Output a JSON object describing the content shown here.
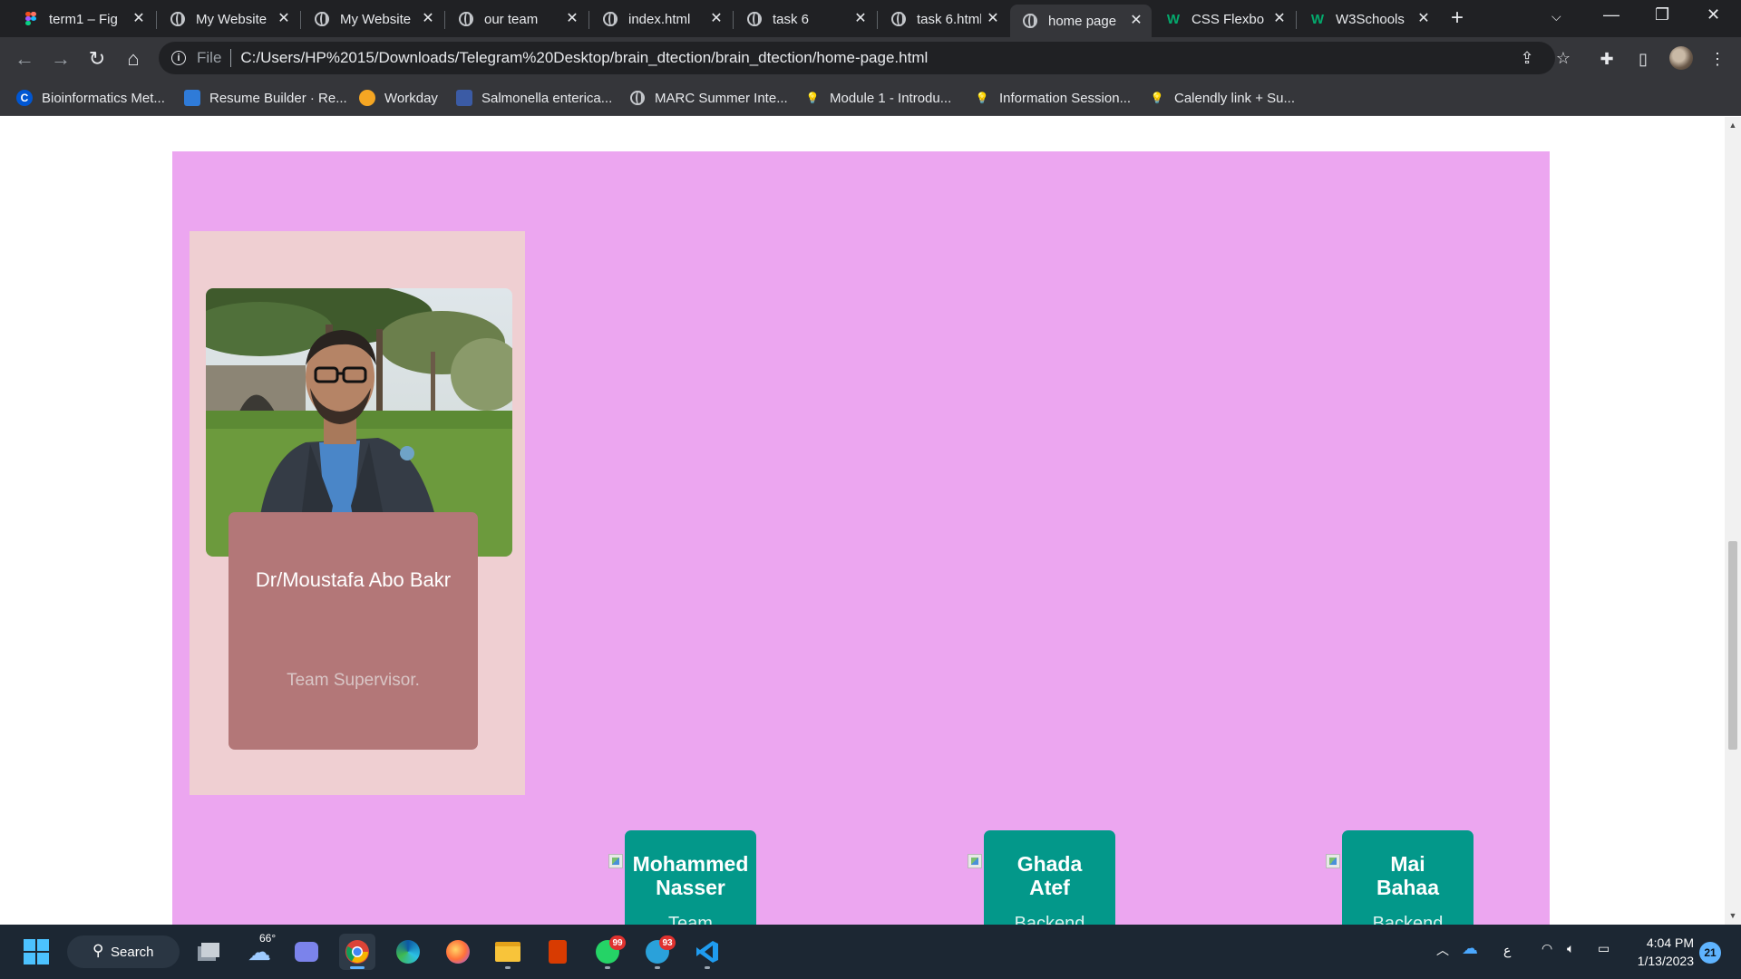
{
  "browser": {
    "tabs": [
      {
        "title": "term1 – Fig",
        "icon": "figma-icon",
        "active": false
      },
      {
        "title": "My Website",
        "icon": "globe-icon",
        "active": false
      },
      {
        "title": "My Website",
        "icon": "globe-icon",
        "active": false
      },
      {
        "title": "our team",
        "icon": "globe-icon",
        "active": false
      },
      {
        "title": "index.html",
        "icon": "globe-icon",
        "active": false
      },
      {
        "title": "task 6",
        "icon": "globe-icon",
        "active": false
      },
      {
        "title": "task 6.html",
        "icon": "globe-icon",
        "active": false
      },
      {
        "title": "home page",
        "icon": "globe-icon",
        "active": true
      },
      {
        "title": "CSS Flexbo",
        "icon": "w3schools-icon",
        "active": false
      },
      {
        "title": "W3Schools",
        "icon": "w3schools-icon",
        "active": false
      }
    ],
    "address": {
      "scheme": "File",
      "url": "C:/Users/HP%2015/Downloads/Telegram%20Desktop/brain_dtection/brain_dtection/home-page.html"
    },
    "bookmarks": [
      {
        "label": "Bioinformatics Met...",
        "icon": "coursera-icon"
      },
      {
        "label": "Resume Builder · Re...",
        "icon": "resume-icon"
      },
      {
        "label": "Workday",
        "icon": "workday-icon"
      },
      {
        "label": "Salmonella enterica...",
        "icon": "document-icon"
      },
      {
        "label": "MARC Summer Inte...",
        "icon": "globe-icon"
      },
      {
        "label": "Module 1 - Introdu...",
        "icon": "bulb-icon"
      },
      {
        "label": "Information Session...",
        "icon": "bulb-icon"
      },
      {
        "label": "Calendly link + Su...",
        "icon": "bulb-icon"
      }
    ]
  },
  "page": {
    "background_color": "#eca6f0",
    "supervisor": {
      "name": "Dr/Moustafa Abo Bakr",
      "role": "Team Supervisor."
    },
    "members": [
      {
        "name": "Mohammed Nasser",
        "role": "Team"
      },
      {
        "name": "Ghada Atef",
        "role": "Backend"
      },
      {
        "name": "Mai Bahaa",
        "role": "Backend"
      }
    ]
  },
  "taskbar": {
    "search_label": "Search",
    "weather": "66°",
    "whatsapp_badge": "99",
    "telegram_badge": "93",
    "input_indicator": "ع",
    "time": "4:04 PM",
    "date": "1/13/2023",
    "notification_count": "21"
  },
  "colors": {
    "accent_teal": "#03988a",
    "supervisor_card": "#efcfd2",
    "supervisor_info": "#b37778"
  }
}
